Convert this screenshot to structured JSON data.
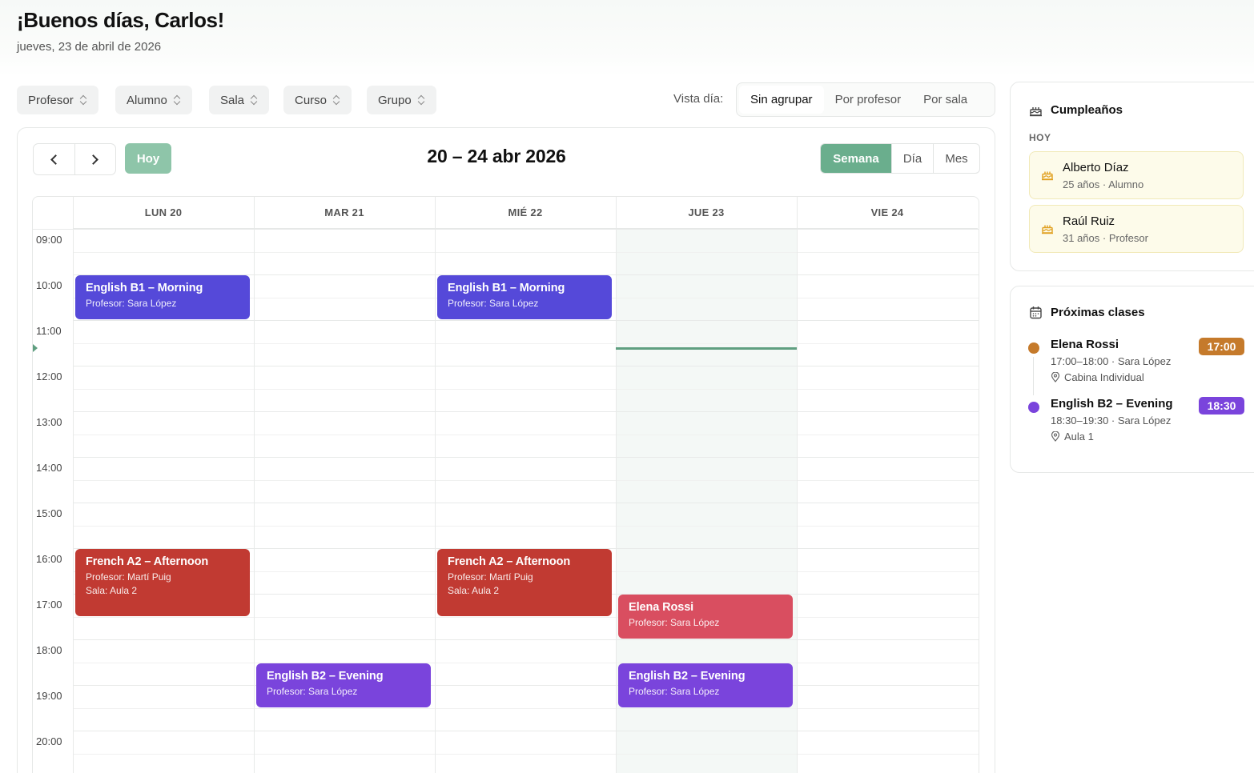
{
  "header": {
    "greeting": "¡Buenos días, Carlos!",
    "date": "jueves, 23 de abril de 2026"
  },
  "filters": [
    "Profesor",
    "Alumno",
    "Sala",
    "Curso",
    "Grupo"
  ],
  "view_day": {
    "label": "Vista día:",
    "options": [
      "Sin agrupar",
      "Por profesor",
      "Por sala"
    ],
    "selected": "Sin agrupar"
  },
  "calendar": {
    "today_button": "Hoy",
    "range_title": "20 – 24 abr 2026",
    "modes": [
      "Semana",
      "Día",
      "Mes"
    ],
    "active_mode": "Semana",
    "days": [
      "LUN 20",
      "MAR 21",
      "MIÉ 22",
      "JUE 23",
      "VIE 24"
    ],
    "today_index": 3,
    "hours": [
      "09:00",
      "10:00",
      "11:00",
      "12:00",
      "13:00",
      "14:00",
      "15:00",
      "16:00",
      "17:00",
      "18:00",
      "19:00",
      "20:00"
    ],
    "now_time": "11:37",
    "events": [
      {
        "day": 0,
        "start": "10:00",
        "end": "11:00",
        "title": "English B1 – Morning",
        "lines": [
          "Profesor: Sara López"
        ],
        "color": "#5549d9"
      },
      {
        "day": 2,
        "start": "10:00",
        "end": "11:00",
        "title": "English B1 – Morning",
        "lines": [
          "Profesor: Sara López"
        ],
        "color": "#5549d9"
      },
      {
        "day": 0,
        "start": "16:00",
        "end": "17:30",
        "title": "French A2 – Afternoon",
        "lines": [
          "Profesor: Martí Puig",
          "Sala: Aula 2"
        ],
        "color": "#c13a32"
      },
      {
        "day": 2,
        "start": "16:00",
        "end": "17:30",
        "title": "French A2 – Afternoon",
        "lines": [
          "Profesor: Martí Puig",
          "Sala: Aula 2"
        ],
        "color": "#c13a32"
      },
      {
        "day": 3,
        "start": "17:00",
        "end": "18:00",
        "title": "Elena Rossi",
        "lines": [
          "Profesor: Sara López"
        ],
        "color": "#d94e60"
      },
      {
        "day": 1,
        "start": "18:30",
        "end": "19:30",
        "title": "English B2 – Evening",
        "lines": [
          "Profesor: Sara López"
        ],
        "color": "#7a44dc"
      },
      {
        "day": 3,
        "start": "18:30",
        "end": "19:30",
        "title": "English B2 – Evening",
        "lines": [
          "Profesor: Sara López"
        ],
        "color": "#7a44dc"
      }
    ]
  },
  "birthdays": {
    "title": "Cumpleaños",
    "today_label": "HOY",
    "items": [
      {
        "name": "Alberto Díaz",
        "meta": "25 años · Alumno"
      },
      {
        "name": "Raúl Ruiz",
        "meta": "31 años · Profesor"
      }
    ],
    "icon": "cake-icon",
    "accent": "#e0a020"
  },
  "upcoming": {
    "title": "Próximas clases",
    "icon": "calendar-icon",
    "items": [
      {
        "name": "Elena Rossi",
        "meta": "17:00–18:00 · Sara López",
        "room": "Cabina Individual",
        "badge": "17:00",
        "color": "#c57a2b"
      },
      {
        "name": "English B2 – Evening",
        "meta": "18:30–19:30 · Sara López",
        "room": "Aula 1",
        "badge": "18:30",
        "color": "#7a44dc"
      }
    ]
  }
}
